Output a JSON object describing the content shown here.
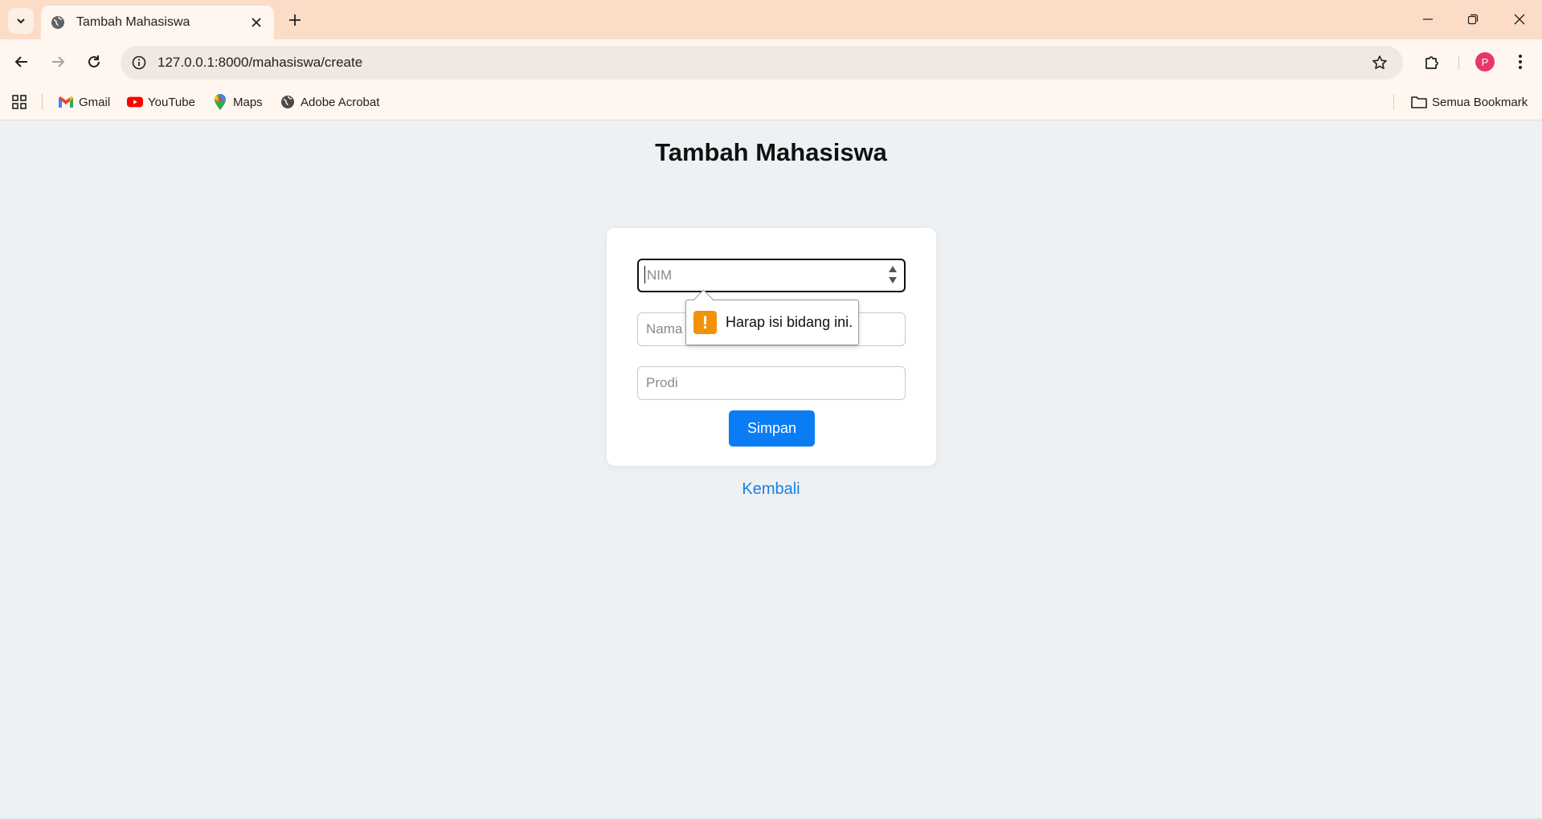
{
  "browser": {
    "tab_title": "Tambah Mahasiswa",
    "url": "127.0.0.1:8000/mahasiswa/create",
    "avatar_initial": "P",
    "bookmarks": [
      {
        "label": "Gmail",
        "icon": "gmail-icon"
      },
      {
        "label": "YouTube",
        "icon": "youtube-icon"
      },
      {
        "label": "Maps",
        "icon": "maps-icon"
      },
      {
        "label": "Adobe Acrobat",
        "icon": "globe-icon"
      }
    ],
    "all_bookmarks_label": "Semua Bookmark"
  },
  "page": {
    "title": "Tambah Mahasiswa",
    "form": {
      "nim_placeholder": "NIM",
      "nama_placeholder": "Nama",
      "prodi_placeholder": "Prodi",
      "submit_label": "Simpan"
    },
    "back_link": "Kembali",
    "validation_message": "Harap isi bidang ini.",
    "validation_icon": "!"
  },
  "colors": {
    "tabbar": "#fbdcc6",
    "toolbar": "#fff6ef",
    "page_bg": "#edf1f4",
    "primary_button": "#0a7df4",
    "link": "#1a7fe0",
    "warning": "#f19208",
    "avatar": "#e8366b"
  }
}
